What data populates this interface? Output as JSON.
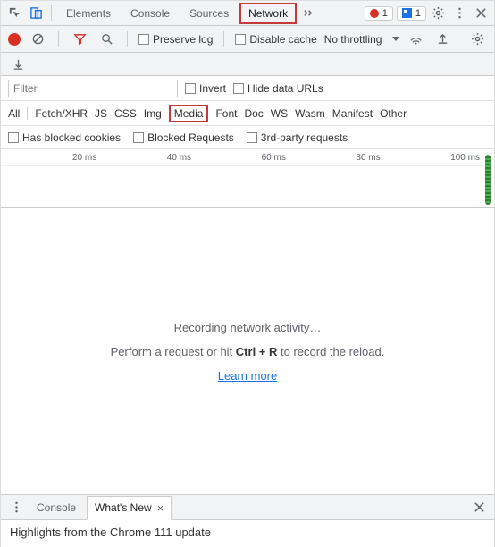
{
  "tabs": [
    "Elements",
    "Console",
    "Sources",
    "Network"
  ],
  "tabs_highlight_index": 3,
  "error_badge": "1",
  "info_badge": "1",
  "toolbar": {
    "preserve_log": "Preserve log",
    "disable_cache": "Disable cache",
    "throttling": "No throttling"
  },
  "filter": {
    "placeholder": "Filter",
    "invert": "Invert",
    "hide_data_urls": "Hide data URLs"
  },
  "types": [
    "All",
    "Fetch/XHR",
    "JS",
    "CSS",
    "Img",
    "Media",
    "Font",
    "Doc",
    "WS",
    "Wasm",
    "Manifest",
    "Other"
  ],
  "types_highlight_index": 5,
  "more_filters": {
    "blocked_cookies": "Has blocked cookies",
    "blocked_requests": "Blocked Requests",
    "third_party": "3rd-party requests"
  },
  "timeline_ticks": [
    "20 ms",
    "40 ms",
    "60 ms",
    "80 ms",
    "100 ms"
  ],
  "main": {
    "recording": "Recording network activity…",
    "perform_pre": "Perform a request or hit ",
    "shortcut": "Ctrl + R",
    "perform_post": " to record the reload.",
    "learn_more": "Learn more"
  },
  "drawer": {
    "tabs": [
      "Console",
      "What's New"
    ],
    "active_index": 1,
    "content": "Highlights from the Chrome 111 update"
  }
}
